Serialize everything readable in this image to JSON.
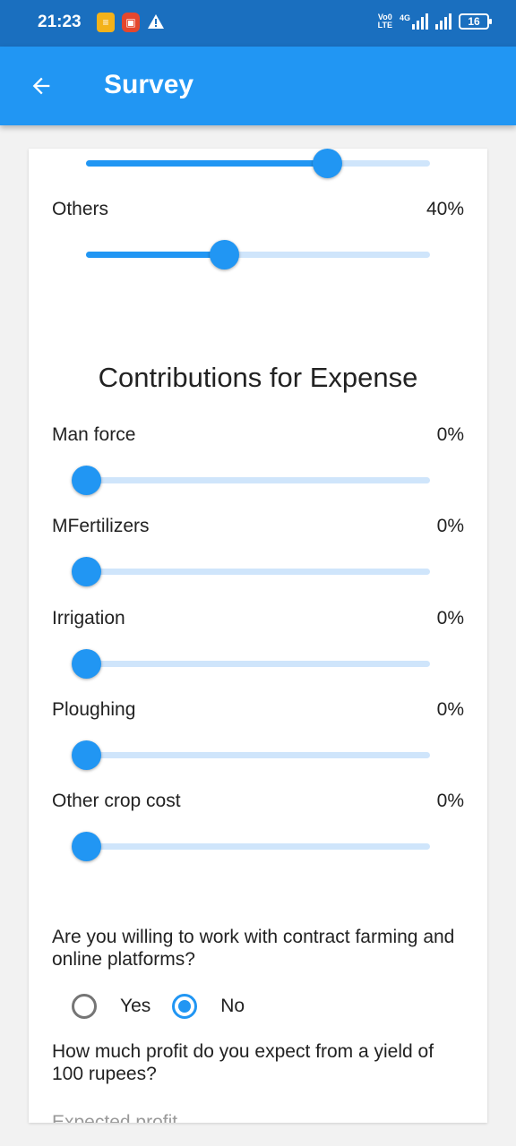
{
  "statusbar": {
    "time": "21:23",
    "net_label_top": "Vo0",
    "net_label_bottom": "LTE",
    "net_type": "4G",
    "battery": "16"
  },
  "appbar": {
    "title": "Survey"
  },
  "top_slider": {
    "value_percent": 70
  },
  "others": {
    "label": "Others",
    "value": "40%",
    "value_percent": 40
  },
  "expense": {
    "title": "Contributions for Expense",
    "items": [
      {
        "label": "Man force",
        "value": "0%",
        "value_percent": 0
      },
      {
        "label": "MFertilizers",
        "value": "0%",
        "value_percent": 0
      },
      {
        "label": "Irrigation",
        "value": "0%",
        "value_percent": 0
      },
      {
        "label": "Ploughing",
        "value": "0%",
        "value_percent": 0
      },
      {
        "label": "Other crop cost",
        "value": "0%",
        "value_percent": 0
      }
    ]
  },
  "contract": {
    "question": "Are you willing to work with contract farming and online platforms?",
    "options": [
      "Yes",
      "No"
    ],
    "selected": "No"
  },
  "profit": {
    "question": "How much profit do you expect from a yield of 100 rupees?",
    "field_label": "Expected profit"
  },
  "colors": {
    "primary": "#2196f3",
    "track": "#cfe5fb",
    "statusbar": "#1a6fbf"
  }
}
